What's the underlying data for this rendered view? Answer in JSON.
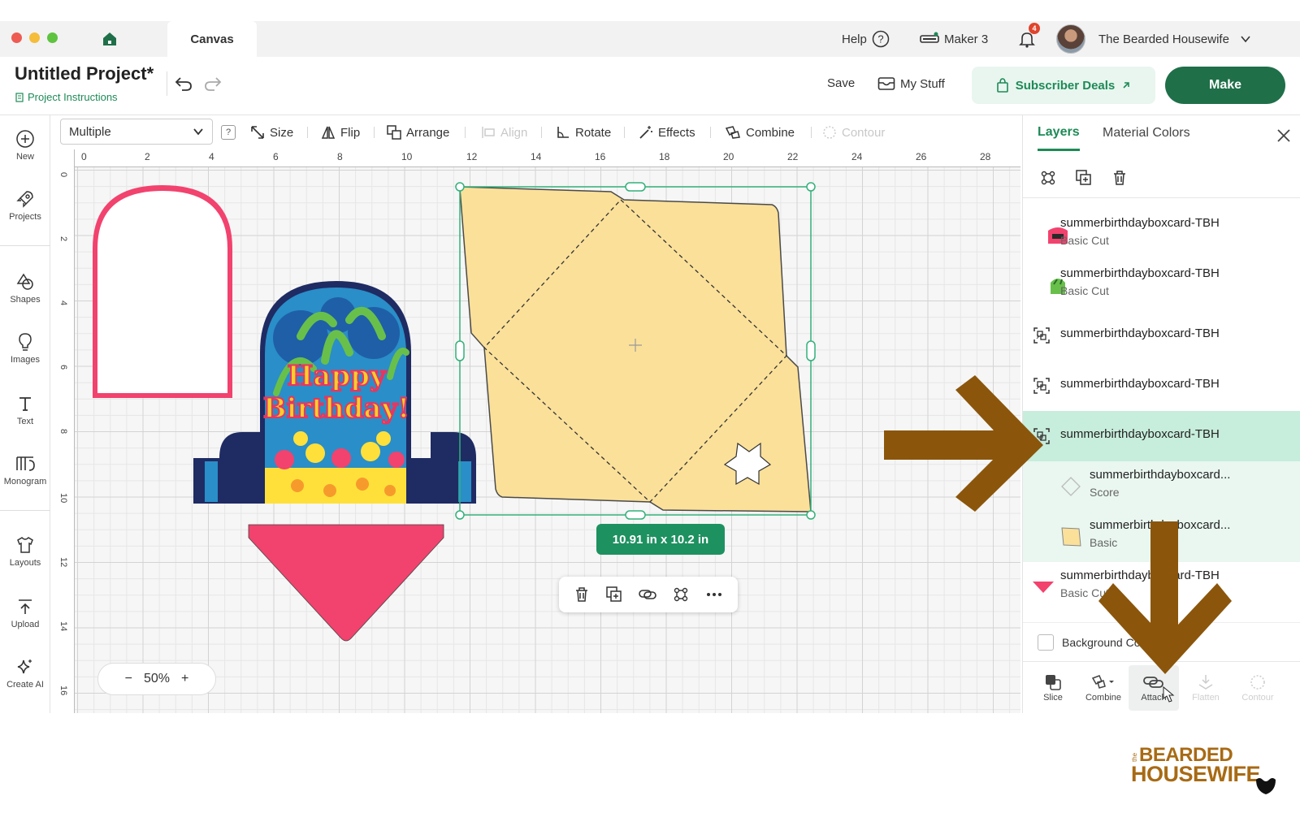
{
  "app": {
    "tab_title": "Canvas",
    "help_label": "Help",
    "machine_label": "Maker 3",
    "notification_count": "4",
    "user_name": "The Bearded Housewife"
  },
  "project": {
    "title": "Untitled Project*",
    "instructions_link": "Project Instructions",
    "save_label": "Save",
    "mystuff_label": "My Stuff",
    "deals_label": "Subscriber Deals",
    "make_label": "Make"
  },
  "sidebar": {
    "items": [
      {
        "label": "New",
        "icon": "plus-circle-icon"
      },
      {
        "label": "Projects",
        "icon": "rocket-icon"
      },
      {
        "label": "Shapes",
        "icon": "shapes-icon"
      },
      {
        "label": "Images",
        "icon": "lightbulb-icon"
      },
      {
        "label": "Text",
        "icon": "text-icon"
      },
      {
        "label": "Monogram",
        "icon": "monogram-icon"
      },
      {
        "label": "Layouts",
        "icon": "tshirt-icon"
      },
      {
        "label": "Upload",
        "icon": "upload-icon"
      },
      {
        "label": "Create AI",
        "icon": "sparkle-icon"
      }
    ]
  },
  "toolbar": {
    "selection_value": "Multiple",
    "help": "?",
    "size": "Size",
    "flip": "Flip",
    "arrange": "Arrange",
    "align": "Align",
    "rotate": "Rotate",
    "effects": "Effects",
    "combine": "Combine",
    "contour": "Contour"
  },
  "ruler": {
    "top": [
      "0",
      "2",
      "4",
      "6",
      "8",
      "10",
      "12",
      "14",
      "16",
      "18",
      "20",
      "22",
      "24",
      "26",
      "28"
    ],
    "left": [
      "0",
      "2",
      "4",
      "6",
      "8",
      "10",
      "12",
      "14",
      "16"
    ]
  },
  "canvas": {
    "size_badge": "10.91  in x 10.2  in",
    "zoom_label": "50%",
    "card_text_line1": "Happy",
    "card_text_line2": "Birthday!"
  },
  "layers_panel": {
    "tab_layers": "Layers",
    "tab_material_colors": "Material Colors",
    "rows": [
      {
        "name": "summerbirthdayboxcard-TBH",
        "sub": "Basic Cut"
      },
      {
        "name": "summerbirthdayboxcard-TBH",
        "sub": "Basic Cut"
      },
      {
        "name": "summerbirthdayboxcard-TBH",
        "sub": ""
      },
      {
        "name": "summerbirthdayboxcard-TBH",
        "sub": ""
      },
      {
        "name": "summerbirthdayboxcard-TBH",
        "sub": ""
      },
      {
        "name": "summerbirthdayboxcard...",
        "sub": "Score"
      },
      {
        "name": "summerbirthdayboxcard...",
        "sub": "Basic"
      },
      {
        "name": "summerbirthdayboxcard-TBH",
        "sub": "Basic Cut"
      }
    ],
    "background_label": "Background Color",
    "bottom": {
      "slice": "Slice",
      "combine": "Combine",
      "attach": "Attach",
      "flatten": "Flatten",
      "contour": "Contour"
    }
  },
  "colors": {
    "accent_green": "#1e8a57",
    "make_green": "#1f6f49",
    "envelope_fill": "#fbe09a",
    "pink": "#f2426e",
    "navy": "#1f2b63",
    "arrow_brown": "#8b560b"
  },
  "watermark": {
    "small": "the",
    "top": "BEARDED",
    "bottom": "HOUSEWIFE"
  }
}
